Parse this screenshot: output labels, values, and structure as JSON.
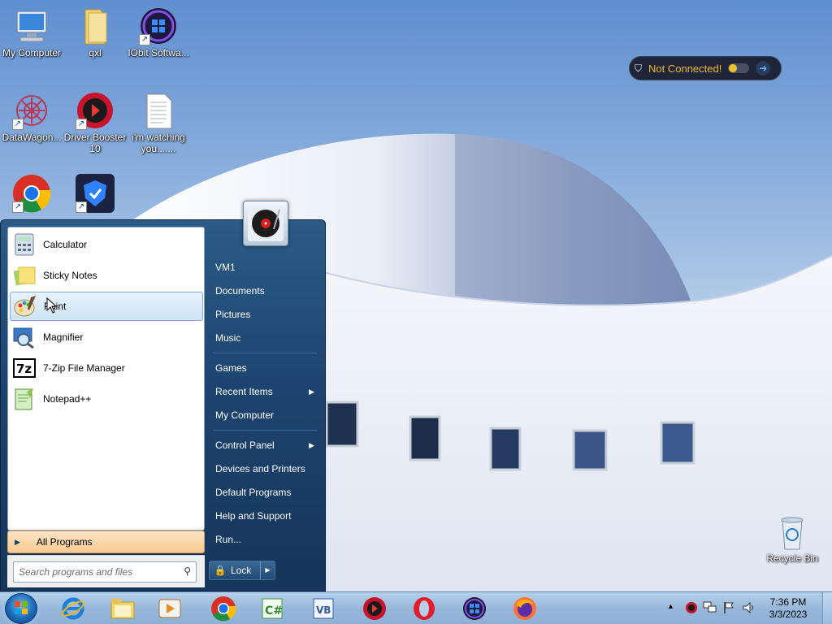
{
  "desktop": {
    "icons": [
      {
        "label": "My Computer",
        "icon": "computer-icon"
      },
      {
        "label": "qxl",
        "icon": "folder-icon"
      },
      {
        "label": "IObit Softwa...",
        "icon": "iobit-icon"
      },
      {
        "label": "DataWagon...",
        "icon": "datawagon-icon"
      },
      {
        "label": "Driver Booster 10",
        "icon": "driver-booster-icon"
      },
      {
        "label": "i'm watching you.......",
        "icon": "text-file-icon"
      },
      {
        "label": "",
        "icon": "chrome-icon"
      },
      {
        "label": "",
        "icon": "vpn-app-icon"
      },
      {
        "label": "Recycle Bin",
        "icon": "recycle-bin-icon"
      }
    ]
  },
  "vpn_widget": {
    "status": "Not Connected!",
    "color": "#f3b62b"
  },
  "start_menu": {
    "programs": [
      {
        "label": "Calculator",
        "icon": "calculator-icon"
      },
      {
        "label": "Sticky Notes",
        "icon": "sticky-notes-icon"
      },
      {
        "label": "Paint",
        "icon": "paint-icon",
        "selected": true
      },
      {
        "label": "Magnifier",
        "icon": "magnifier-icon"
      },
      {
        "label": "7-Zip File Manager",
        "icon": "7zip-icon"
      },
      {
        "label": "Notepad++",
        "icon": "notepadpp-icon"
      }
    ],
    "all_programs": "All Programs",
    "search_placeholder": "Search programs and files",
    "right_items": [
      {
        "label": "VM1"
      },
      {
        "label": "Documents"
      },
      {
        "label": "Pictures"
      },
      {
        "label": "Music"
      },
      {
        "label": "Games"
      },
      {
        "label": "Recent Items",
        "submenu": true
      },
      {
        "label": "My Computer"
      },
      {
        "label": "Control Panel",
        "submenu": true
      },
      {
        "label": "Devices and Printers"
      },
      {
        "label": "Default Programs"
      },
      {
        "label": "Help and Support"
      },
      {
        "label": "Run..."
      }
    ],
    "lock_label": "Lock"
  },
  "taskbar": {
    "pinned": [
      {
        "name": "internet-explorer-icon"
      },
      {
        "name": "file-explorer-icon"
      },
      {
        "name": "media-player-icon"
      },
      {
        "name": "chrome-icon"
      },
      {
        "name": "csharp-icon",
        "text": "C#"
      },
      {
        "name": "vb-icon",
        "text": "VB"
      },
      {
        "name": "driver-booster-icon"
      },
      {
        "name": "opera-icon"
      },
      {
        "name": "iobit-icon"
      },
      {
        "name": "firefox-icon"
      }
    ],
    "clock_time": "7:36 PM",
    "clock_date": "3/3/2023"
  }
}
